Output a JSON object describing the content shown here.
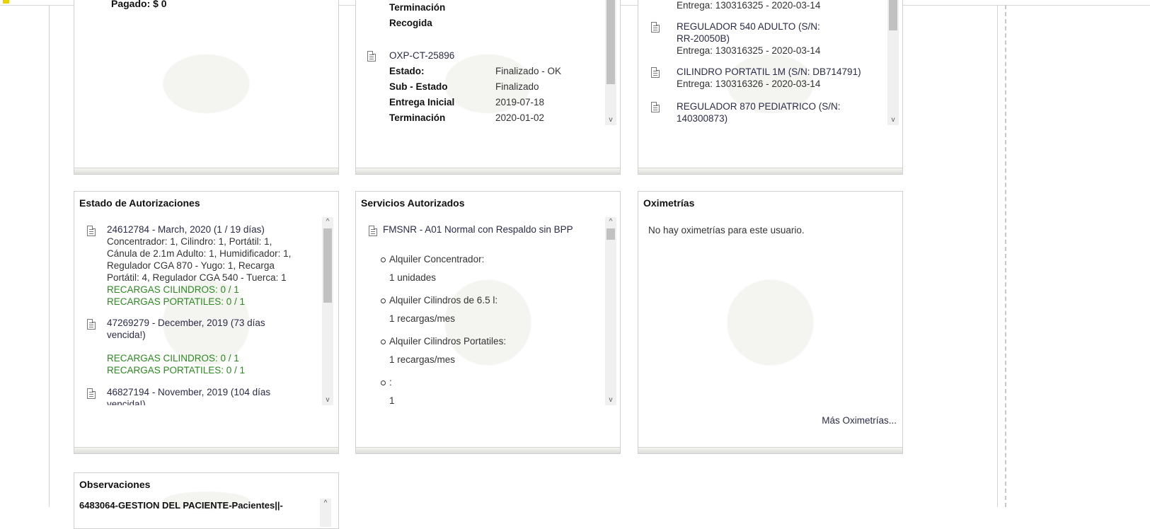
{
  "colors": {
    "link": "#2b2b4a",
    "green": "#2a8a1e",
    "panel_border": "#d0d0d0"
  },
  "panel1": {
    "partial_text": "Pagado: $ 0"
  },
  "panel2": {
    "partial_top": [
      "Terminación",
      "Recogida"
    ],
    "order_link": "OXP-CT-25896",
    "rows": [
      {
        "label": "Estado:",
        "value": "Finalizado - OK"
      },
      {
        "label": "Sub - Estado",
        "value": "Finalizado"
      },
      {
        "label": "Entrega Inicial",
        "value": "2019-07-18"
      },
      {
        "label": "Terminación",
        "value": "2020-01-02"
      }
    ]
  },
  "panel3": {
    "partial_top": "Entrega: 130316325 - 2020-03-14",
    "items": [
      {
        "name_lines": [
          "REGULADOR 540 ADULTO (S/N:",
          "RR-20050B)"
        ],
        "entrega": "Entrega: 130316325 - 2020-03-14"
      },
      {
        "name_lines": [
          "CILINDRO PORTATIL 1M (S/N: DB714791)"
        ],
        "entrega": "Entrega: 130316326 - 2020-03-14"
      },
      {
        "name_lines": [
          "REGULADOR 870 PEDIATRICO (S/N:",
          "140300873)"
        ],
        "entrega": ""
      }
    ]
  },
  "autorizaciones": {
    "title": "Estado de Autorizaciones",
    "items": [
      {
        "header": "24612784 - March, 2020 (1 / 19 días)",
        "detail_lines": [
          "Concentrador: 1, Cilindro: 1, Portátil: 1,",
          "Cánula de 2.1m Adulto: 1, Humidificador: 1,",
          "Regulador CGA 870 - Yugo: 1, Recarga",
          "Portátil: 4, Regulador CGA 540 - Tuerca: 1"
        ],
        "green_lines": [
          "RECARGAS CILINDROS: 0 / 1",
          "RECARGAS PORTATILES: 0 / 1"
        ]
      },
      {
        "header_lines": [
          "47269279 - December, 2019 (73 días",
          "vencida!)"
        ],
        "green_lines": [
          "RECARGAS CILINDROS: 0 / 1",
          "RECARGAS PORTATILES: 0 / 1"
        ]
      },
      {
        "header_lines": [
          "46827194 - November, 2019 (104 días",
          "vencida!)"
        ]
      }
    ]
  },
  "servicios": {
    "title": "Servicios Autorizados",
    "service_link": "FMSNR - A01 Normal con Respaldo sin BPP",
    "items": [
      {
        "name": "Alquiler Concentrador:",
        "value": "1 unidades"
      },
      {
        "name": "Alquiler Cilindros de 6.5 l:",
        "value": "1 recargas/mes"
      },
      {
        "name": "Alquiler Cilindros Portatiles:",
        "value": "1 recargas/mes"
      },
      {
        "name": ":",
        "value": "1"
      }
    ]
  },
  "oximetrias": {
    "title": "Oximetrías",
    "empty_text": "No hay oximetrías para este usuario.",
    "more_link": "Más Oximetrías..."
  },
  "observaciones": {
    "title": "Observaciones",
    "partial_text": "6483064-GESTION DEL PACIENTE-Pacientes||-"
  },
  "scroll": {
    "up_glyph": "^",
    "down_glyph": "v"
  }
}
